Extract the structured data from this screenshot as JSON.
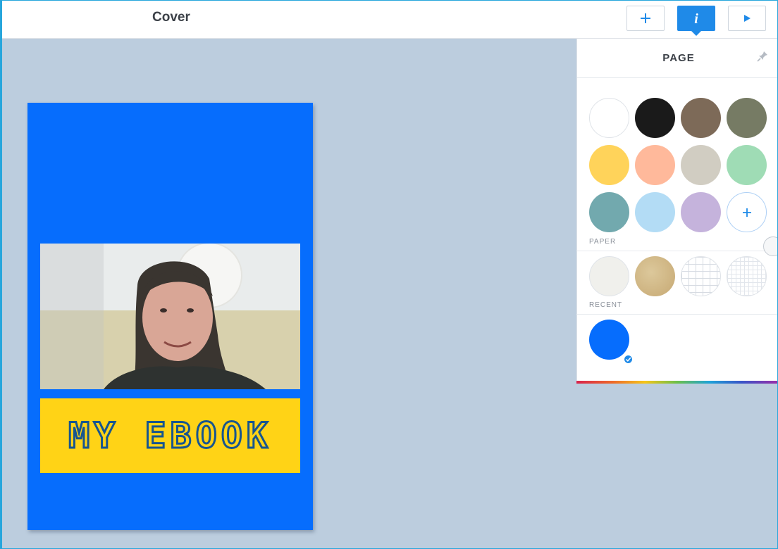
{
  "header": {
    "title": "Cover",
    "add_button_icon": "plus-icon",
    "info_button_icon": "info-icon",
    "play_button_icon": "play-icon"
  },
  "cover": {
    "banner_text": "MY EBOOK",
    "background_color": "#066dfd",
    "banner_color": "#ffd316",
    "banner_text_color": "#17558f"
  },
  "panel": {
    "title": "PAGE",
    "pin_icon": "pin-icon",
    "colors": [
      "#ffffff",
      "#1a1a1a",
      "#7d6a58",
      "#767b64",
      "#ffd35a",
      "#ffb99b",
      "#d1cdc2",
      "#9fdcb5",
      "#72a9ae",
      "#b3dcf5",
      "#c5b3dc"
    ],
    "add_color_icon": "plus-icon",
    "paper_label": "PAPER",
    "papers": [
      "off-white paper",
      "kraft paper",
      "grid paper",
      "fine grid paper"
    ],
    "recent_label": "RECENT",
    "recent": [
      {
        "color": "#066dfd",
        "selected": true
      }
    ]
  }
}
